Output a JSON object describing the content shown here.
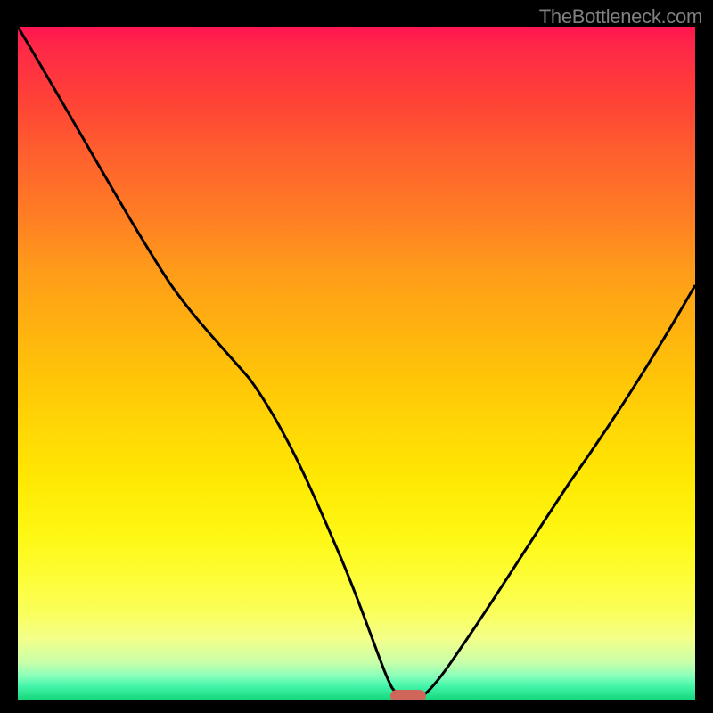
{
  "watermark": "TheBottleneck.com",
  "chart_data": {
    "type": "line",
    "title": "",
    "xlabel": "",
    "ylabel": "",
    "xlim": [
      0,
      100
    ],
    "ylim": [
      0,
      100
    ],
    "series": [
      {
        "name": "bottleneck-curve",
        "x": [
          0,
          10,
          20,
          28,
          34,
          40,
          46,
          52,
          55,
          57,
          58,
          62,
          66,
          72,
          80,
          90,
          100
        ],
        "values": [
          100,
          82,
          66,
          60,
          52,
          41,
          27,
          10,
          2,
          0,
          0,
          2,
          7,
          15,
          28,
          45,
          62
        ]
      }
    ],
    "marker": {
      "x": 57.5,
      "y": 0.5,
      "label": "optimal-point"
    },
    "background": {
      "type": "vertical-gradient",
      "stops": [
        {
          "pos": 0,
          "color": "#ff1450"
        },
        {
          "pos": 0.5,
          "color": "#ffd805"
        },
        {
          "pos": 0.85,
          "color": "#fdfd38"
        },
        {
          "pos": 1,
          "color": "#15d77d"
        }
      ]
    }
  }
}
